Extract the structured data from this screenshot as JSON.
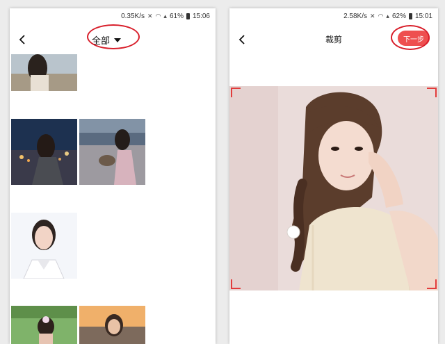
{
  "left_screen": {
    "status": {
      "speed": "0.35K/s",
      "battery": "61%",
      "time": "15:06"
    },
    "nav": {
      "album_label": "全部"
    }
  },
  "right_screen": {
    "status": {
      "speed": "2.58K/s",
      "battery": "62%",
      "time": "15:01"
    },
    "nav": {
      "title": "裁剪",
      "next_label": "下一步"
    }
  },
  "colors": {
    "accent": "#ee4f4f",
    "callout": "#d81e2a",
    "crop_corner": "#e23c3c"
  },
  "icons": {
    "back": "chevron-left-icon",
    "dropdown": "caret-down-icon",
    "wifi": "wifi-icon",
    "signal": "signal-icon",
    "mute": "mute-icon",
    "battery": "battery-icon"
  }
}
